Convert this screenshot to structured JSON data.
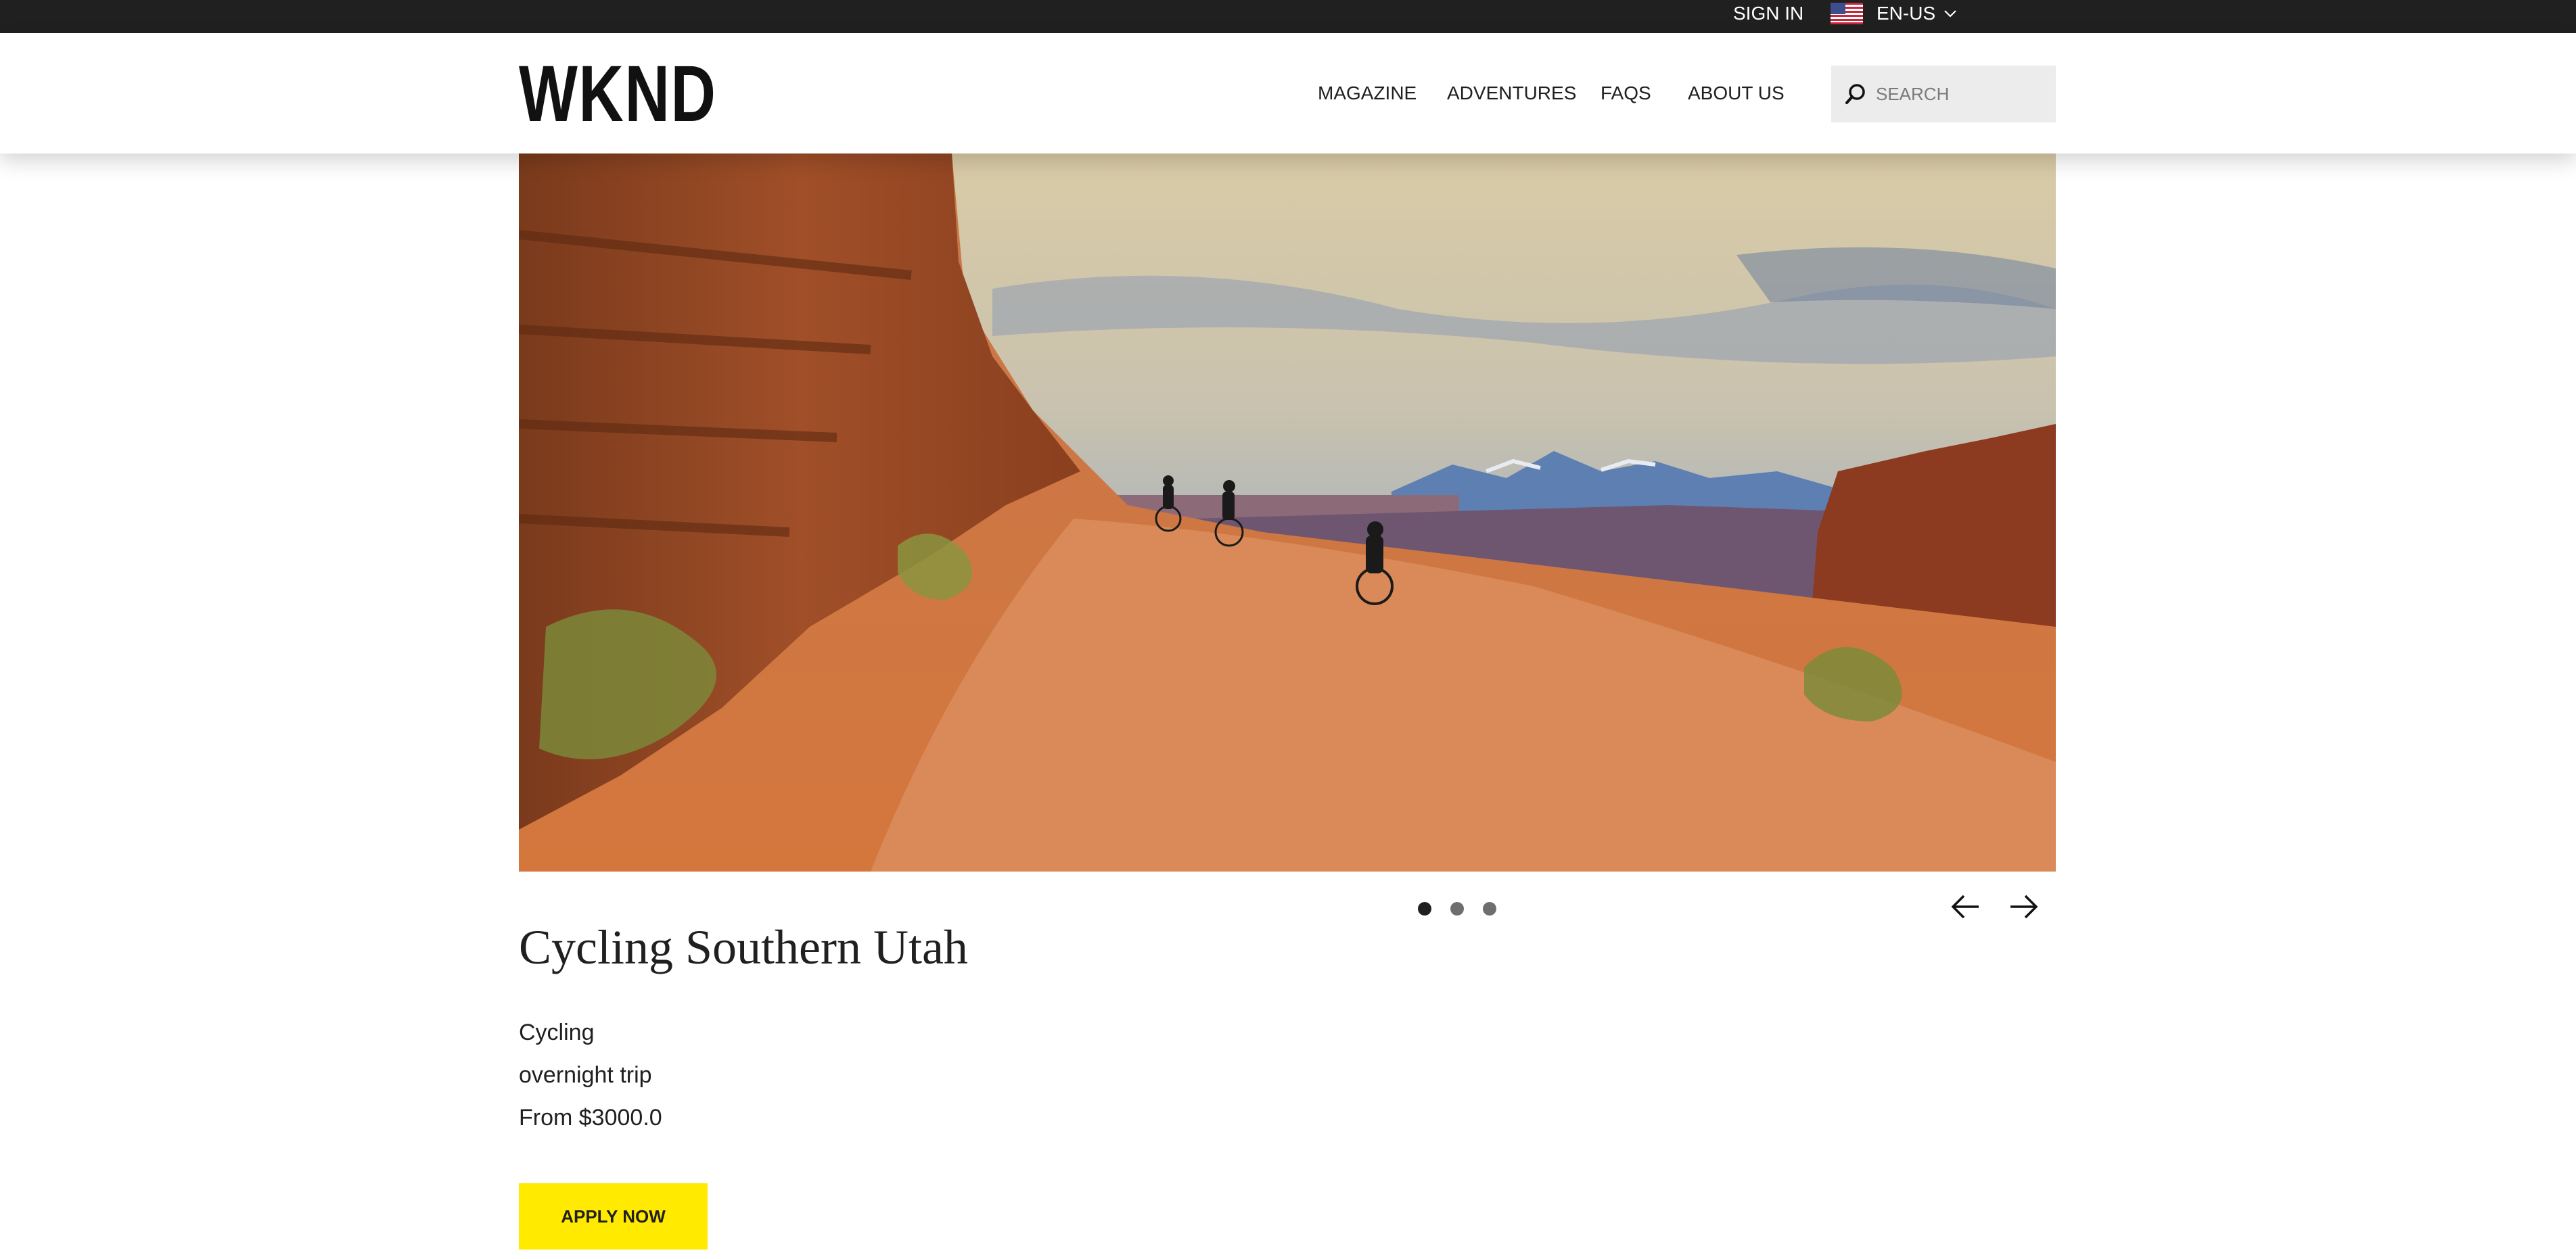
{
  "topbar": {
    "sign_in": "SIGN IN",
    "language": "EN-US",
    "flag_icon": "us-flag-icon",
    "chevron_icon": "chevron-down-icon"
  },
  "header": {
    "logo": "WKND",
    "nav": [
      "MAGAZINE",
      "ADVENTURES",
      "FAQS",
      "ABOUT US"
    ],
    "search": {
      "placeholder": "SEARCH",
      "icon": "search-icon"
    }
  },
  "carousel": {
    "image_icon": "hero-image",
    "slides_count": 3,
    "active_slide": 1,
    "prev_icon": "arrow-left-icon",
    "next_icon": "arrow-right-icon"
  },
  "adventure": {
    "title": "Cycling Southern Utah",
    "details": [
      "Cycling",
      "overnight trip",
      "From $3000.0"
    ],
    "cta": "APPLY NOW"
  },
  "colors": {
    "topbar": "#202020",
    "cta": "#ffea00",
    "search_bg": "#ececec",
    "text": "#202020"
  }
}
